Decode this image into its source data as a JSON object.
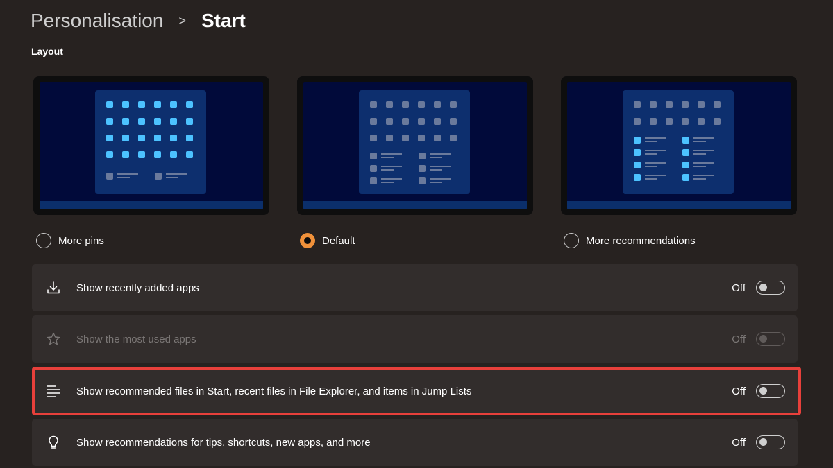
{
  "breadcrumb": {
    "parent": "Personalisation",
    "separator": ">",
    "current": "Start"
  },
  "layout_section": {
    "heading": "Layout",
    "options": [
      {
        "label": "More pins",
        "selected": false
      },
      {
        "label": "Default",
        "selected": true
      },
      {
        "label": "More recommendations",
        "selected": false
      }
    ]
  },
  "settings": [
    {
      "icon": "download-icon",
      "label": "Show recently added apps",
      "state": "Off",
      "enabled": true
    },
    {
      "icon": "star-icon",
      "label": "Show the most used apps",
      "state": "Off",
      "enabled": false
    },
    {
      "icon": "list-lines-icon",
      "label": "Show recommended files in Start, recent files in File Explorer, and items in Jump Lists",
      "state": "Off",
      "enabled": true,
      "highlighted": true
    },
    {
      "icon": "lightbulb-icon",
      "label": "Show recommendations for tips, shortcuts, new apps, and more",
      "state": "Off",
      "enabled": true
    }
  ],
  "colors": {
    "background": "#272220",
    "row_background": "#322d2c",
    "accent": "#f0913a",
    "highlight_border": "#e8403b",
    "preview_screen": "#010a3a",
    "preview_menu": "#0d2f6e",
    "icon_bright": "#4cc2ff",
    "icon_dim": "#6a7a9c"
  }
}
